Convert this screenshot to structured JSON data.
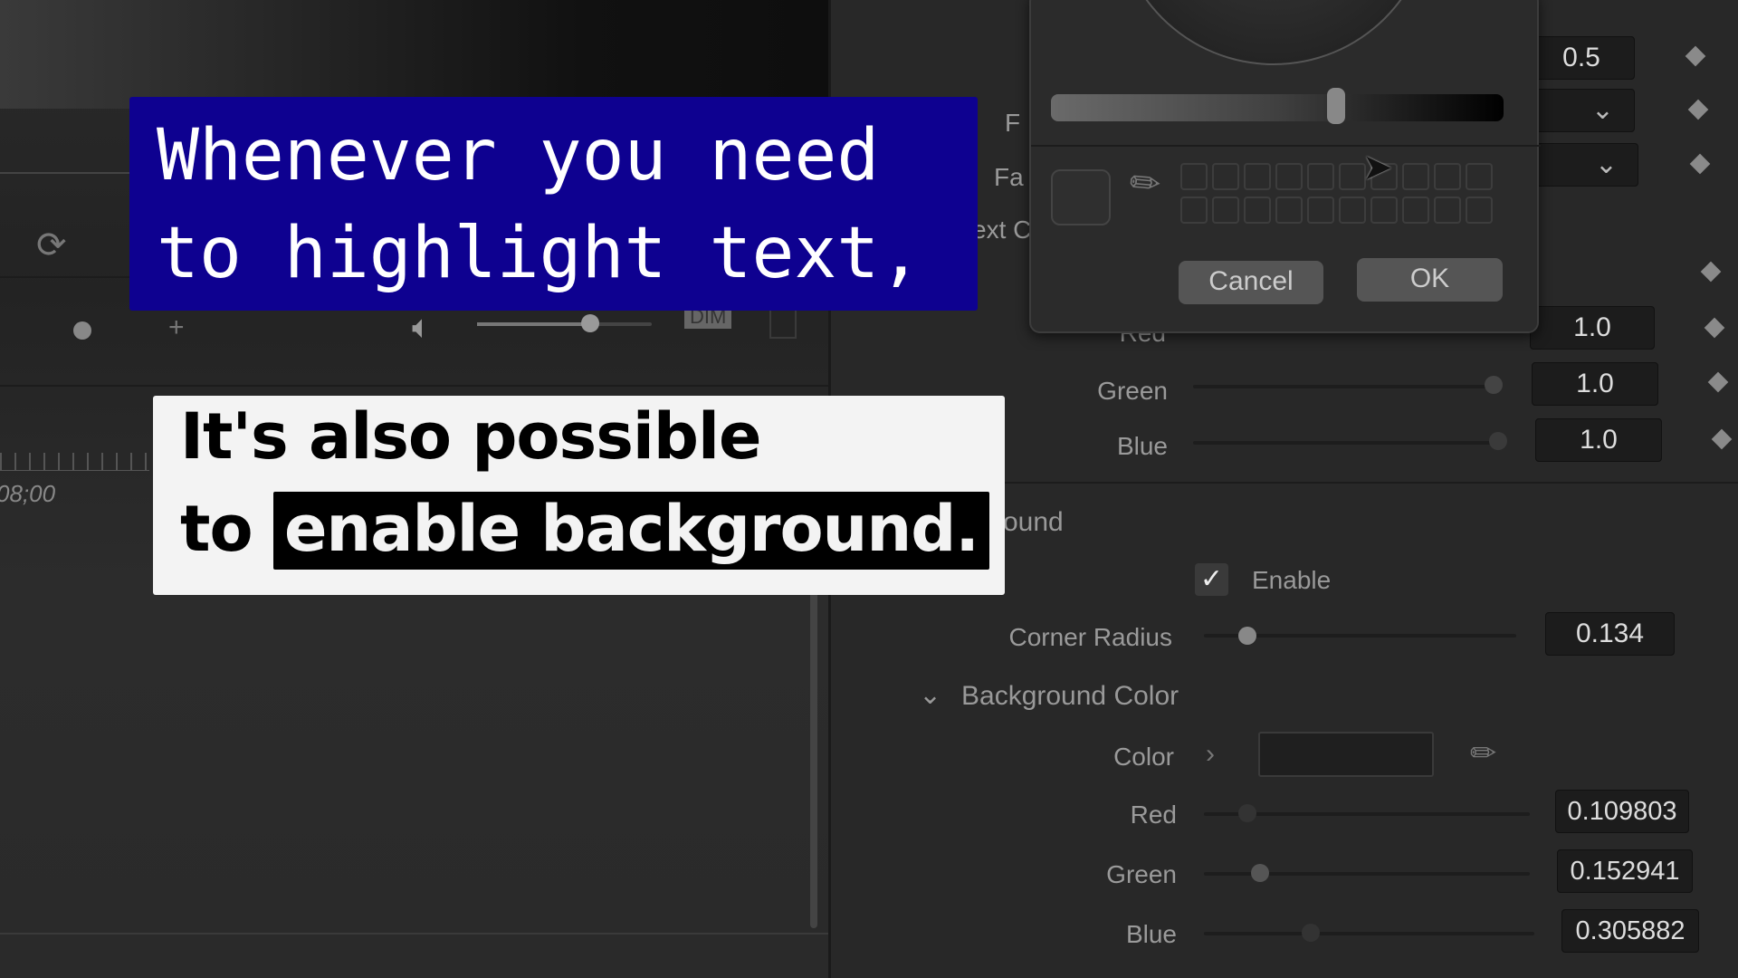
{
  "captions": {
    "line1": "Whenever you need",
    "line2": "to highlight text,",
    "callout_line1": "It's also possible",
    "callout_line2_prefix": "to",
    "callout_highlight": "enable background.",
    "callout_highlight_bg": "#000000",
    "caption_bg": "#0e0190"
  },
  "left_panel": {
    "timecode": "08;00",
    "dim_label": "DIM",
    "volume_level": 0.65,
    "icons": [
      "loop-icon",
      "zoom-plus-icon",
      "speaker-icon"
    ]
  },
  "color_dialog": {
    "cancel_label": "Cancel",
    "ok_label": "OK",
    "brightness_level": 0.63
  },
  "inspector": {
    "top_value": "0.5",
    "partial_labels": [
      "F",
      "Fa",
      "ext C"
    ],
    "text_color": {
      "red_label": "Red",
      "red_value": "1.0",
      "green_label": "Green",
      "green_value": "1.0",
      "blue_label": "Blue",
      "blue_value": "1.0"
    },
    "background_section_partial": "ound",
    "enable_label": "Enable",
    "enable_checked": true,
    "corner_radius_label": "Corner Radius",
    "corner_radius_value": "0.134",
    "background_color_header": "Background Color",
    "color_label": "Color",
    "bg_red_label": "Red",
    "bg_red_value": "0.109803",
    "bg_green_label": "Green",
    "bg_green_value": "0.152941",
    "bg_blue_label": "Blue",
    "bg_blue_value": "0.305882"
  }
}
